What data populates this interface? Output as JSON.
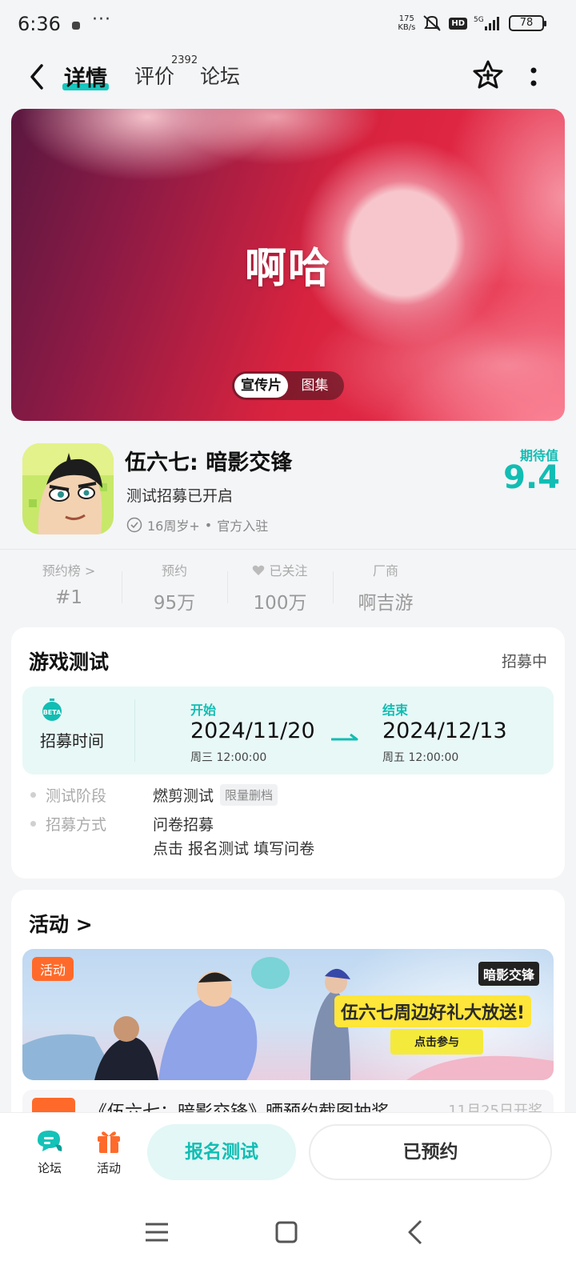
{
  "status_bar": {
    "time": "6:36",
    "more": "···",
    "net_speed_value": "175",
    "net_speed_unit": "KB/s",
    "hd": "HD",
    "network": "5G",
    "battery": "78"
  },
  "header": {
    "tabs": [
      {
        "label": "详情",
        "active": true
      },
      {
        "label": "评价",
        "badge": "2392"
      },
      {
        "label": "论坛"
      }
    ]
  },
  "banner": {
    "title": "啊哈",
    "toggle": [
      "宣传片",
      "图集"
    ]
  },
  "game": {
    "name": "伍六七: 暗影交锋",
    "status": "测试招募已开启",
    "age": "16周岁+",
    "official": "官方入驻",
    "expect_label": "期待值",
    "expect_value": "9.4"
  },
  "stats": [
    {
      "label": "预约榜 >",
      "value": "#1"
    },
    {
      "label": "预约",
      "value": "95万"
    },
    {
      "label": "已关注",
      "value": "100万"
    },
    {
      "label": "厂商",
      "value": "啊吉游"
    }
  ],
  "test_card": {
    "title": "游戏测试",
    "status": "招募中",
    "beta_label": "BETA",
    "recruit_label": "招募时间",
    "start_label": "开始",
    "start_date": "2024/11/20",
    "start_time": "周三  12:00:00",
    "end_label": "结束",
    "end_date": "2024/12/13",
    "end_time": "周五  12:00:00",
    "stage_key": "测试阶段",
    "stage_val": "燃剪测试",
    "stage_tag": "限量删档",
    "method_key": "招募方式",
    "method_val": "问卷招募",
    "method_note": "点击 报名测试 填写问卷"
  },
  "activity_card": {
    "title": "活动 >",
    "tag": "活动",
    "headline": "伍六七周边好礼大放送!",
    "logo": "暗影交锋",
    "button": "点击参与",
    "next_text": "《伍六七：暗影交锋》晒预约截图抽奖",
    "next_date": "11月25日开奖"
  },
  "bottom_bar": {
    "forum": "论坛",
    "activity": "活动",
    "signup": "报名测试",
    "reserved": "已预约"
  },
  "colors": {
    "accent": "#12bdb3",
    "orange": "#ff6a2a"
  }
}
